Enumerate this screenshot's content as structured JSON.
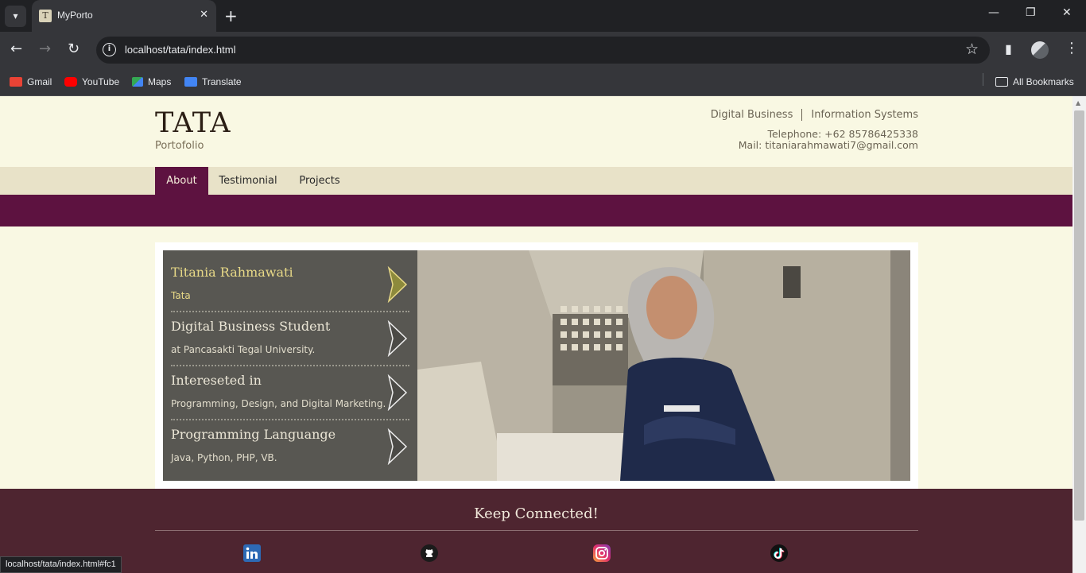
{
  "browser": {
    "tab_title": "MyPorto",
    "tab_favicon": "T",
    "url": "localhost/tata/index.html",
    "status_url": "localhost/tata/index.html#fc1",
    "bookmarks": [
      "Gmail",
      "YouTube",
      "Maps",
      "Translate"
    ],
    "all_bookmarks": "All Bookmarks"
  },
  "site": {
    "logo": "TATA",
    "tagline": "Portofolio",
    "topics": [
      "Digital Business",
      "Information Systems"
    ],
    "telephone": "Telephone: +62 85786425338",
    "mail": "Mail: titaniarahmawati7@gmail.com"
  },
  "nav": {
    "items": [
      "About",
      "Testimonial",
      "Projects"
    ],
    "active": "About"
  },
  "about": [
    {
      "title": "Titania Rahmawati",
      "subtitle": "Tata"
    },
    {
      "title": "Digital Business Student",
      "subtitle": "at Pancasakti Tegal University."
    },
    {
      "title": "Intereseted in",
      "subtitle": "Programming, Design, and Digital Marketing."
    },
    {
      "title": "Programming Languange",
      "subtitle": "Java, Python, PHP, VB."
    }
  ],
  "footer": {
    "title": "Keep Connected!",
    "social": [
      "linkedin-icon",
      "github-icon",
      "instagram-icon",
      "tiktok-icon"
    ]
  },
  "colors": {
    "accent": "#5d1240",
    "footer": "#4e2530",
    "page_bg": "#f9f8e3",
    "panel": "#585752",
    "highlight": "#e8d987"
  }
}
